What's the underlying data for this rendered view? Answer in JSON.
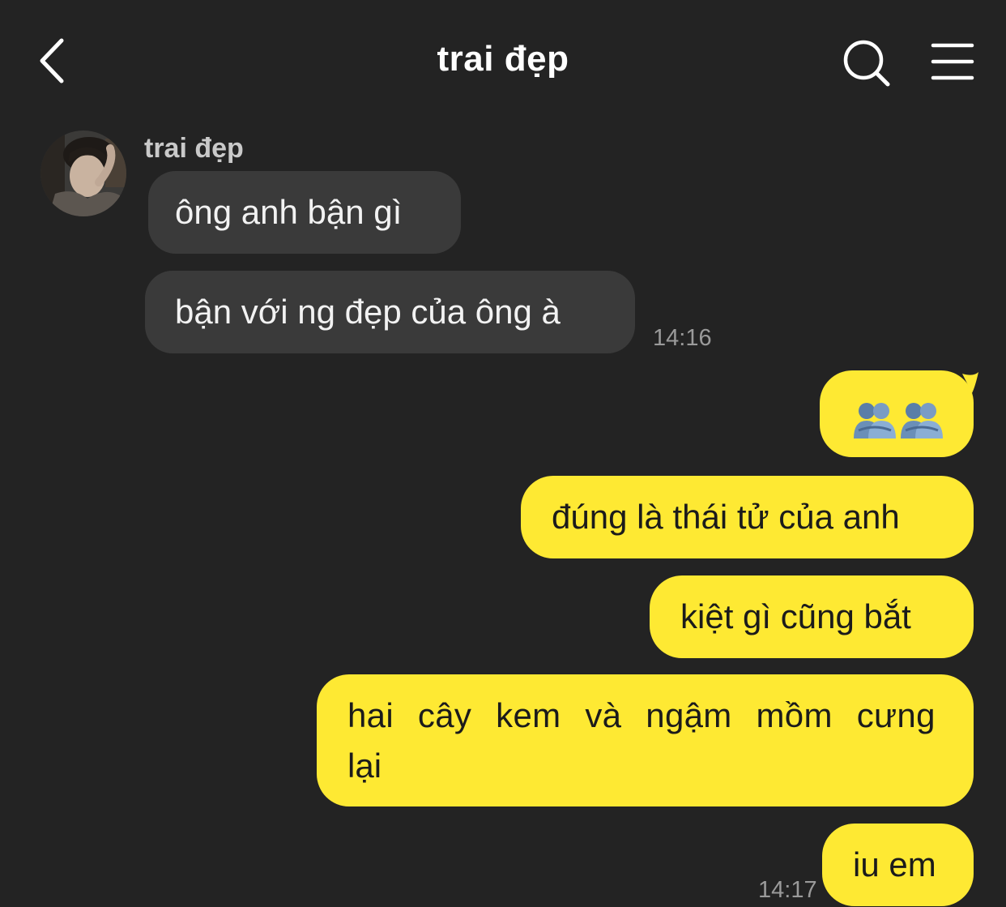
{
  "header": {
    "title": "trai đẹp",
    "back_icon": "chevron-left-icon",
    "search_icon": "search-icon",
    "menu_icon": "hamburger-menu-icon"
  },
  "conversation": {
    "sender_name": "trai đẹp",
    "incoming": [
      {
        "text": "ông anh bận gì"
      },
      {
        "text": "bận với ng đẹp của ông à",
        "time": "14:16"
      }
    ],
    "outgoing": [
      {
        "emoji": "👥👥"
      },
      {
        "text": "đúng là thái tử của anh"
      },
      {
        "text": "kiệt gì cũng bắt"
      },
      {
        "line1": "hai cây kem và ngậm mồm cưng",
        "line2": "lại"
      },
      {
        "text": "iu em",
        "time": "14:17"
      }
    ]
  },
  "colors": {
    "background": "#232323",
    "incoming_bubble": "#3a3a3a",
    "outgoing_bubble": "#fee933",
    "timestamp": "#9a9a9a"
  }
}
